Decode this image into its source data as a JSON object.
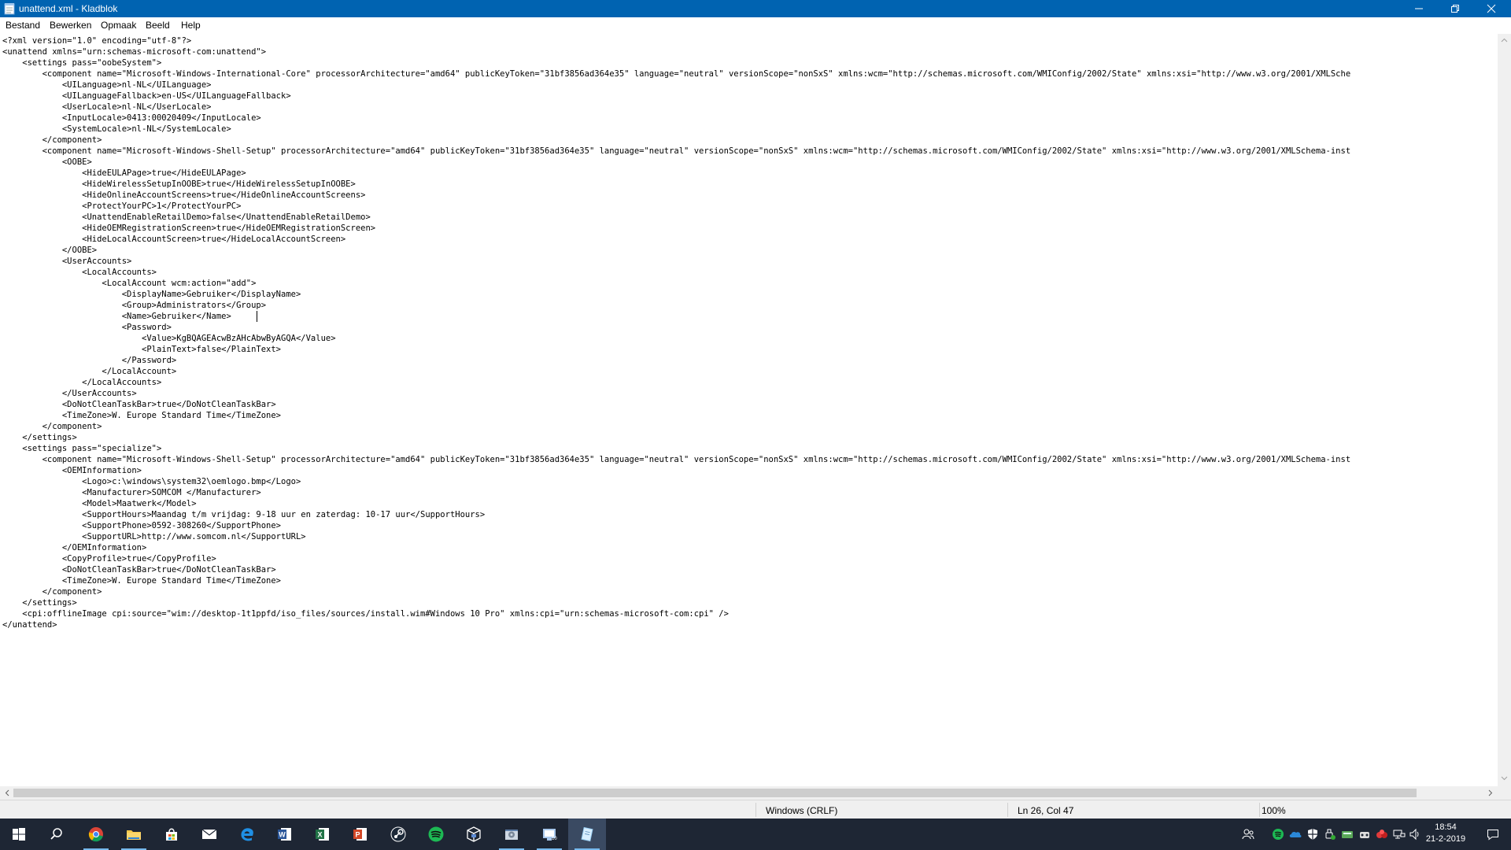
{
  "window": {
    "title": "unattend.xml - Kladblok"
  },
  "menu": {
    "bestand": "Bestand",
    "bewerken": "Bewerken",
    "opmaak": "Opmaak",
    "beeld": "Beeld",
    "help": "Help"
  },
  "editor": {
    "text": "<?xml version=\"1.0\" encoding=\"utf-8\"?>\n<unattend xmlns=\"urn:schemas-microsoft-com:unattend\">\n    <settings pass=\"oobeSystem\">\n        <component name=\"Microsoft-Windows-International-Core\" processorArchitecture=\"amd64\" publicKeyToken=\"31bf3856ad364e35\" language=\"neutral\" versionScope=\"nonSxS\" xmlns:wcm=\"http://schemas.microsoft.com/WMIConfig/2002/State\" xmlns:xsi=\"http://www.w3.org/2001/XMLSche\n            <UILanguage>nl-NL</UILanguage>\n            <UILanguageFallback>en-US</UILanguageFallback>\n            <UserLocale>nl-NL</UserLocale>\n            <InputLocale>0413:00020409</InputLocale>\n            <SystemLocale>nl-NL</SystemLocale>\n        </component>\n        <component name=\"Microsoft-Windows-Shell-Setup\" processorArchitecture=\"amd64\" publicKeyToken=\"31bf3856ad364e35\" language=\"neutral\" versionScope=\"nonSxS\" xmlns:wcm=\"http://schemas.microsoft.com/WMIConfig/2002/State\" xmlns:xsi=\"http://www.w3.org/2001/XMLSchema-inst\n            <OOBE>\n                <HideEULAPage>true</HideEULAPage>\n                <HideWirelessSetupInOOBE>true</HideWirelessSetupInOOBE>\n                <HideOnlineAccountScreens>true</HideOnlineAccountScreens>\n                <ProtectYourPC>1</ProtectYourPC>\n                <UnattendEnableRetailDemo>false</UnattendEnableRetailDemo>\n                <HideOEMRegistrationScreen>true</HideOEMRegistrationScreen>\n                <HideLocalAccountScreen>true</HideLocalAccountScreen>\n            </OOBE>\n            <UserAccounts>\n                <LocalAccounts>\n                    <LocalAccount wcm:action=\"add\">\n                        <DisplayName>Gebruiker</DisplayName>\n                        <Group>Administrators</Group>\n                        <Name>Gebruiker</Name>\n                        <Password>\n                            <Value>KgBQAGEAcwBzAHcAbwByAGQA</Value>\n                            <PlainText>false</PlainText>\n                        </Password>\n                    </LocalAccount>\n                </LocalAccounts>\n            </UserAccounts>\n            <DoNotCleanTaskBar>true</DoNotCleanTaskBar>\n            <TimeZone>W. Europe Standard Time</TimeZone>\n        </component>\n    </settings>\n    <settings pass=\"specialize\">\n        <component name=\"Microsoft-Windows-Shell-Setup\" processorArchitecture=\"amd64\" publicKeyToken=\"31bf3856ad364e35\" language=\"neutral\" versionScope=\"nonSxS\" xmlns:wcm=\"http://schemas.microsoft.com/WMIConfig/2002/State\" xmlns:xsi=\"http://www.w3.org/2001/XMLSchema-inst\n            <OEMInformation>\n                <Logo>c:\\windows\\system32\\oemlogo.bmp</Logo>\n                <Manufacturer>SOMCOM </Manufacturer>\n                <Model>Maatwerk</Model>\n                <SupportHours>Maandag t/m vrijdag: 9-18 uur en zaterdag: 10-17 uur</SupportHours>\n                <SupportPhone>0592-308260</SupportPhone>\n                <SupportURL>http://www.somcom.nl</SupportURL>\n            </OEMInformation>\n            <CopyProfile>true</CopyProfile>\n            <DoNotCleanTaskBar>true</DoNotCleanTaskBar>\n            <TimeZone>W. Europe Standard Time</TimeZone>\n        </component>\n    </settings>\n    <cpi:offlineImage cpi:source=\"wim://desktop-1t1ppfd/iso_files/sources/install.wim#Windows 10 Pro\" xmlns:cpi=\"urn:schemas-microsoft-com:cpi\" />\n</unattend>"
  },
  "status": {
    "line_ending": "Windows (CRLF)",
    "position": "Ln 26, Col 47",
    "zoom": "100%"
  },
  "taskbar": {
    "apps": [
      {
        "id": "chrome",
        "icon": "chrome-icon",
        "running": true
      },
      {
        "id": "explorer",
        "icon": "folder-icon",
        "running": true
      },
      {
        "id": "store",
        "icon": "store-icon",
        "running": false
      },
      {
        "id": "mail",
        "icon": "mail-icon",
        "running": false
      },
      {
        "id": "edge",
        "icon": "edge-icon",
        "running": false
      },
      {
        "id": "word",
        "icon": "word-icon",
        "running": false
      },
      {
        "id": "excel",
        "icon": "excel-icon",
        "running": false
      },
      {
        "id": "powerpoint",
        "icon": "powerpoint-icon",
        "running": false
      },
      {
        "id": "steam",
        "icon": "steam-icon",
        "running": false
      },
      {
        "id": "spotify",
        "icon": "spotify-icon",
        "running": false
      },
      {
        "id": "virtualbox",
        "icon": "virtualbox-icon",
        "running": false
      },
      {
        "id": "settings-tool",
        "icon": "settings-tool-icon",
        "running": true
      },
      {
        "id": "system-tool",
        "icon": "system-tool-icon",
        "running": true
      },
      {
        "id": "notepad",
        "icon": "notepad-icon",
        "running": true,
        "active": true
      }
    ],
    "tray_icons": [
      "people-icon",
      "spotify-tray-icon",
      "onedrive-icon",
      "defender-icon",
      "usb-icon",
      "network-activity-icon",
      "audio-device-icon",
      "red-app-icon",
      "network-icon",
      "volume-icon"
    ],
    "clock": {
      "time": "18:54",
      "date": "21-2-2019"
    }
  },
  "colors": {
    "titlebar": "#0063b1",
    "taskbar": "#1e2634",
    "accent": "#76b9ed"
  }
}
